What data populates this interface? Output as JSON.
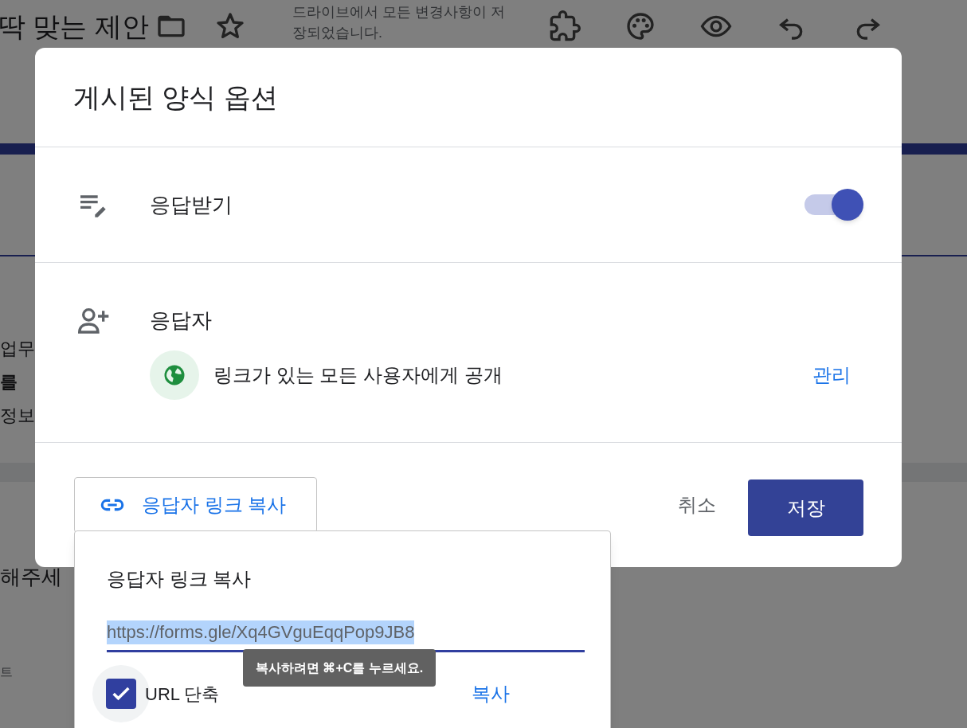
{
  "background": {
    "header_title": "딱 맞는 제안",
    "save_status": "드라이브에서 모든 변경사항이 저장되었습니다.",
    "fragments": [
      {
        "kind": "text",
        "text": "업무"
      },
      {
        "kind": "bold",
        "text": "를"
      },
      {
        "kind": "text",
        "text": "정보"
      },
      {
        "kind": "question",
        "text": "해주세"
      },
      {
        "kind": "small",
        "text": "트"
      }
    ]
  },
  "dialog": {
    "title": "게시된 양식 옵션",
    "sections": [
      {
        "kind": "toggle",
        "label": "응답받기",
        "on": true
      },
      {
        "kind": "audience",
        "label": "응답자",
        "access": "링크가 있는 모든 사용자에게 공개",
        "manage": "관리"
      }
    ],
    "copy_link_button": "응답자 링크 복사",
    "cancel": "취소",
    "save": "저장"
  },
  "popup": {
    "title": "응답자 링크 복사",
    "url": "https://forms.gle/Xq4GVguEqqPop9JB8",
    "url_selected": true,
    "shorten": {
      "label": "URL 단축",
      "checked": true
    },
    "tooltip": "복사하려면 ⌘+C를 누르세요.",
    "copy": "복사"
  }
}
